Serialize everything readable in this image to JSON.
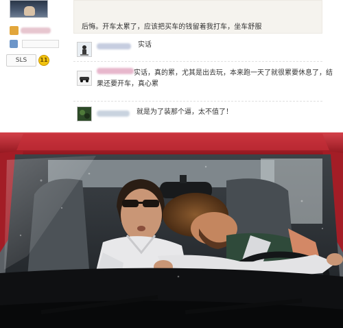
{
  "post": {
    "text": "后悔。开车太累了，应该把买车的钱留着我打车，坐车舒服"
  },
  "user_panel": {
    "medal_label": "SLS",
    "medal_level": "11"
  },
  "replies": [
    {
      "text": "实话"
    },
    {
      "text_line1": "实话，真的累，尤其是出去玩，本来跑一天了就很累要休息了，结",
      "text_line2": "果还要开车，真心累"
    },
    {
      "text": "就是为了装那个逼，太不值了！"
    }
  ],
  "icons": [
    "user-avatar-icon",
    "rank-icon",
    "medal-badge-icon"
  ],
  "colors": {
    "post_background": "#f5f3ee",
    "car_red": "#b8232b",
    "medal_gold": "#f1c30f"
  }
}
